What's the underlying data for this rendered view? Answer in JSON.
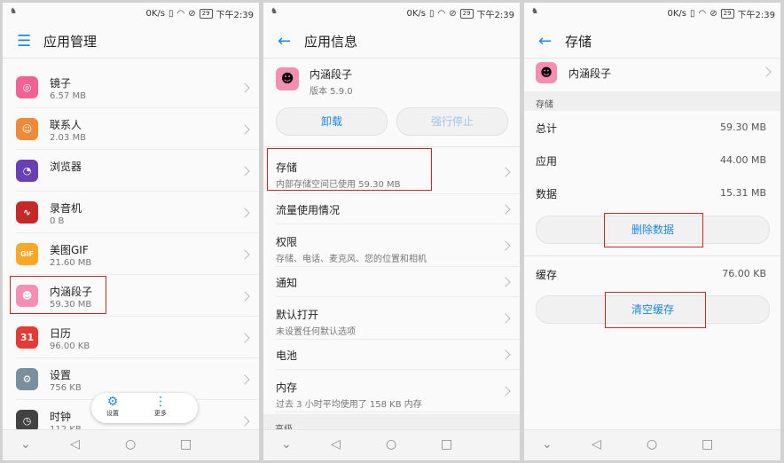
{
  "status": {
    "speed": "0K/s",
    "battery": "29",
    "time": "下午2:39"
  },
  "screen1": {
    "title": "应用管理",
    "apps": [
      {
        "name": "镜子",
        "size": "6.57 MB",
        "icon": "mirror-icon",
        "color": "#f06292",
        "glyph": "◎"
      },
      {
        "name": "联系人",
        "size": "2.03 MB",
        "icon": "contacts-icon",
        "color": "#ef8a3a",
        "glyph": "☺"
      },
      {
        "name": "浏览器",
        "size": "",
        "icon": "browser-icon",
        "color": "#6a3fb5",
        "glyph": "◔"
      },
      {
        "name": "录音机",
        "size": "0 B",
        "icon": "recorder-icon",
        "color": "#c62828",
        "glyph": "∿"
      },
      {
        "name": "美图GIF",
        "size": "21.60 MB",
        "icon": "gif-icon",
        "color": "#f9a825",
        "glyph": "GIF"
      },
      {
        "name": "内涵段子",
        "size": "59.30 MB",
        "icon": "neihan-icon",
        "color": "#f48fb1",
        "glyph": "☻"
      },
      {
        "name": "日历",
        "size": "96.00 KB",
        "icon": "calendar-icon",
        "color": "#e53935",
        "glyph": "31"
      },
      {
        "name": "设置",
        "size": "756 KB",
        "icon": "settings-icon",
        "color": "#78909c",
        "glyph": "⚙"
      },
      {
        "name": "时钟",
        "size": "112 KB",
        "icon": "clock-icon",
        "color": "#424242",
        "glyph": "◷"
      }
    ],
    "float_settings": "设置",
    "float_more": "更多"
  },
  "screen2": {
    "title": "应用信息",
    "app_name": "内涵段子",
    "version": "版本 5.9.0",
    "uninstall": "卸载",
    "force_stop": "强行停止",
    "rows": [
      {
        "title": "存储",
        "sub": "内部存储空间已使用 59.30 MB"
      },
      {
        "title": "流量使用情况",
        "sub": ""
      },
      {
        "title": "权限",
        "sub": "存储、电话、麦克风、您的位置和相机"
      },
      {
        "title": "通知",
        "sub": ""
      },
      {
        "title": "默认打开",
        "sub": "未设置任何默认选项"
      },
      {
        "title": "电池",
        "sub": ""
      },
      {
        "title": "内存",
        "sub": "过去 3 小时平均使用了 158 KB 内存"
      }
    ],
    "section_advanced": "高级"
  },
  "screen3": {
    "title": "存储",
    "app_name": "内涵段子",
    "section_storage": "存储",
    "total_label": "总计",
    "total_value": "59.30 MB",
    "app_label": "应用",
    "app_value": "44.00 MB",
    "data_label": "数据",
    "data_value": "15.31 MB",
    "clear_data": "删除数据",
    "cache_label": "缓存",
    "cache_value": "76.00 KB",
    "clear_cache": "清空缓存"
  },
  "colors": {
    "accent": "#1e88e5",
    "highlight_box": "#c62828"
  }
}
